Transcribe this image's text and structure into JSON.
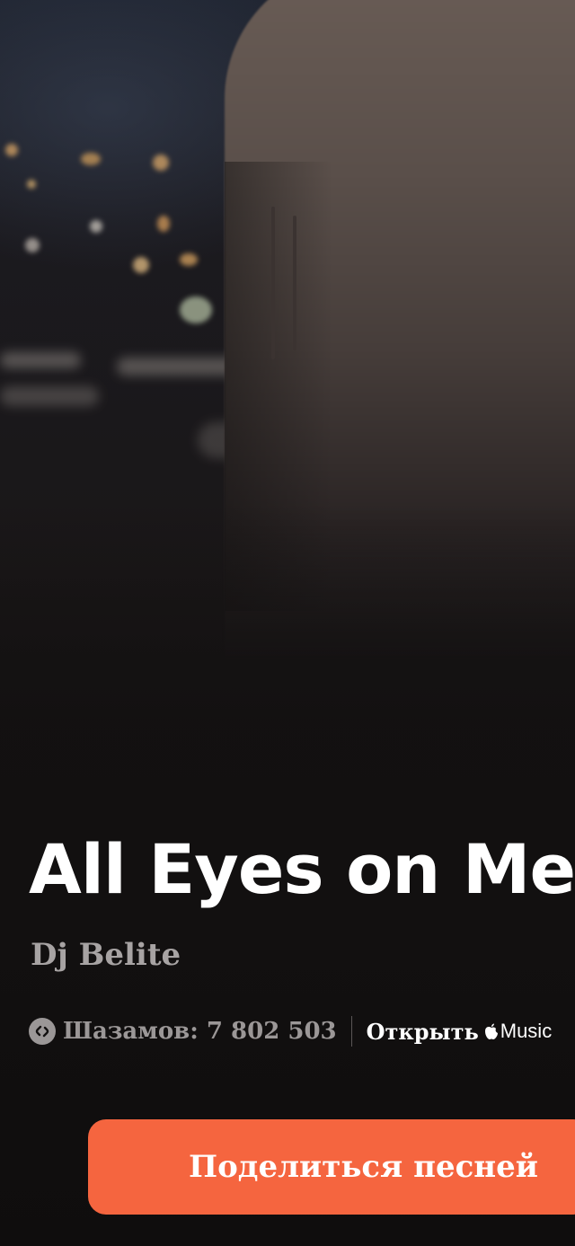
{
  "song": {
    "title": "All Eyes on Me",
    "artist": "Dj Belite"
  },
  "stats": {
    "shazam_icon": "shazam-logo-icon",
    "shazam_count": "Шазамов: 7 802 503"
  },
  "open_in": {
    "label": "Открыть",
    "service_icon": "apple-logo-icon",
    "service": "Music"
  },
  "actions": {
    "share_label": "Поделиться песней"
  },
  "colors": {
    "accent": "#f5653f",
    "background": "#121010",
    "secondary_text": "#a7a3a3"
  }
}
